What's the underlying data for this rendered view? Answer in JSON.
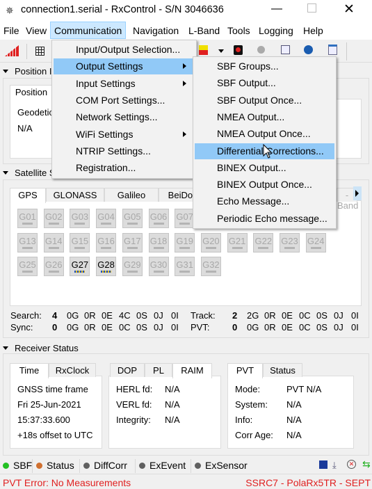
{
  "window": {
    "title": "connection1.serial - RxControl - S/N 3046636"
  },
  "menubar": [
    "File",
    "View",
    "Communication",
    "Navigation",
    "L-Band",
    "Tools",
    "Logging",
    "Help"
  ],
  "communication_menu": [
    {
      "label": "Input/Output Selection...",
      "submenu": false
    },
    {
      "label": "Output Settings",
      "submenu": true,
      "highlighted": true
    },
    {
      "label": "Input Settings",
      "submenu": true
    },
    {
      "label": "COM Port Settings...",
      "submenu": false
    },
    {
      "label": "Network Settings...",
      "submenu": false
    },
    {
      "label": "WiFi Settings",
      "submenu": true
    },
    {
      "label": "NTRIP Settings...",
      "submenu": false
    },
    {
      "label": "Registration...",
      "submenu": false
    }
  ],
  "output_settings_menu": [
    {
      "label": "SBF Groups..."
    },
    {
      "label": "SBF Output..."
    },
    {
      "label": "SBF Output Once..."
    },
    {
      "label": "NMEA Output..."
    },
    {
      "label": "NMEA Output Once..."
    },
    {
      "label": "Differential Corrections...",
      "highlighted": true
    },
    {
      "label": "BINEX Output..."
    },
    {
      "label": "BINEX Output Once..."
    },
    {
      "label": "Echo Message..."
    },
    {
      "label": "Periodic Echo message..."
    }
  ],
  "position": {
    "header": "Position I",
    "tab": "Position",
    "label": "Geodetic",
    "value": "N/A"
  },
  "satellite": {
    "header": "Satellite S",
    "tabs": [
      "GPS",
      "GLONASS",
      "Galileo",
      "BeiDou",
      "-Band"
    ],
    "sats": [
      "G01",
      "G02",
      "G03",
      "G04",
      "G05",
      "G06",
      "G07",
      "G08",
      "G09",
      "G10",
      "G11",
      "G12",
      "G13",
      "G14",
      "G15",
      "G16",
      "G17",
      "G18",
      "G19",
      "G20",
      "G21",
      "G22",
      "G23",
      "G24",
      "G25",
      "G26",
      "G27",
      "G28",
      "G29",
      "G30",
      "G31",
      "G32"
    ],
    "active": [
      "G27",
      "G28"
    ],
    "search": {
      "label": "Search:",
      "total": "4",
      "counts": [
        "0G",
        "0R",
        "0E",
        "4C",
        "0S",
        "0J",
        "0I"
      ]
    },
    "sync": {
      "label": "Sync:",
      "total": "0",
      "counts": [
        "0G",
        "0R",
        "0E",
        "0C",
        "0S",
        "0J",
        "0I"
      ]
    },
    "track": {
      "label": "Track:",
      "total": "2",
      "counts": [
        "2G",
        "0R",
        "0E",
        "0C",
        "0S",
        "0J",
        "0I"
      ]
    },
    "pvt": {
      "label": "PVT:",
      "total": "0",
      "counts": [
        "0G",
        "0R",
        "0E",
        "0C",
        "0S",
        "0J",
        "0I"
      ]
    }
  },
  "receiver": {
    "header": "Receiver Status",
    "time_tabs": [
      "Time",
      "RxClock"
    ],
    "time_lines": [
      "GNSS time frame",
      "Fri 25-Jun-2021",
      "15:37:33.600",
      "+18s offset to UTC"
    ],
    "dop_tabs": [
      "DOP",
      "PL",
      "RAIM"
    ],
    "raim": [
      {
        "k": "HERL fd:",
        "v": "N/A"
      },
      {
        "k": "VERL fd:",
        "v": "N/A"
      },
      {
        "k": "Integrity:",
        "v": "N/A"
      }
    ],
    "pvt_tabs": [
      "PVT",
      "Status"
    ],
    "pvt": [
      {
        "k": "Mode:",
        "v": "PVT N/A"
      },
      {
        "k": "System:",
        "v": "N/A"
      },
      {
        "k": "Info:",
        "v": "N/A"
      },
      {
        "k": "Corr Age:",
        "v": "N/A"
      }
    ]
  },
  "statusbar": {
    "indicators": [
      {
        "label": "SBF",
        "color": "#22c022"
      },
      {
        "label": "Status",
        "color": "#d07030"
      },
      {
        "label": "DiffCorr",
        "color": "#606060"
      },
      {
        "label": "ExEvent",
        "color": "#606060"
      },
      {
        "label": "ExSensor",
        "color": "#606060"
      }
    ]
  },
  "footer": {
    "error": "PVT Error: No Measurements",
    "receiver": "SSRC7 - PolaRx5TR - SEPT",
    "error_color": "#e02020"
  }
}
